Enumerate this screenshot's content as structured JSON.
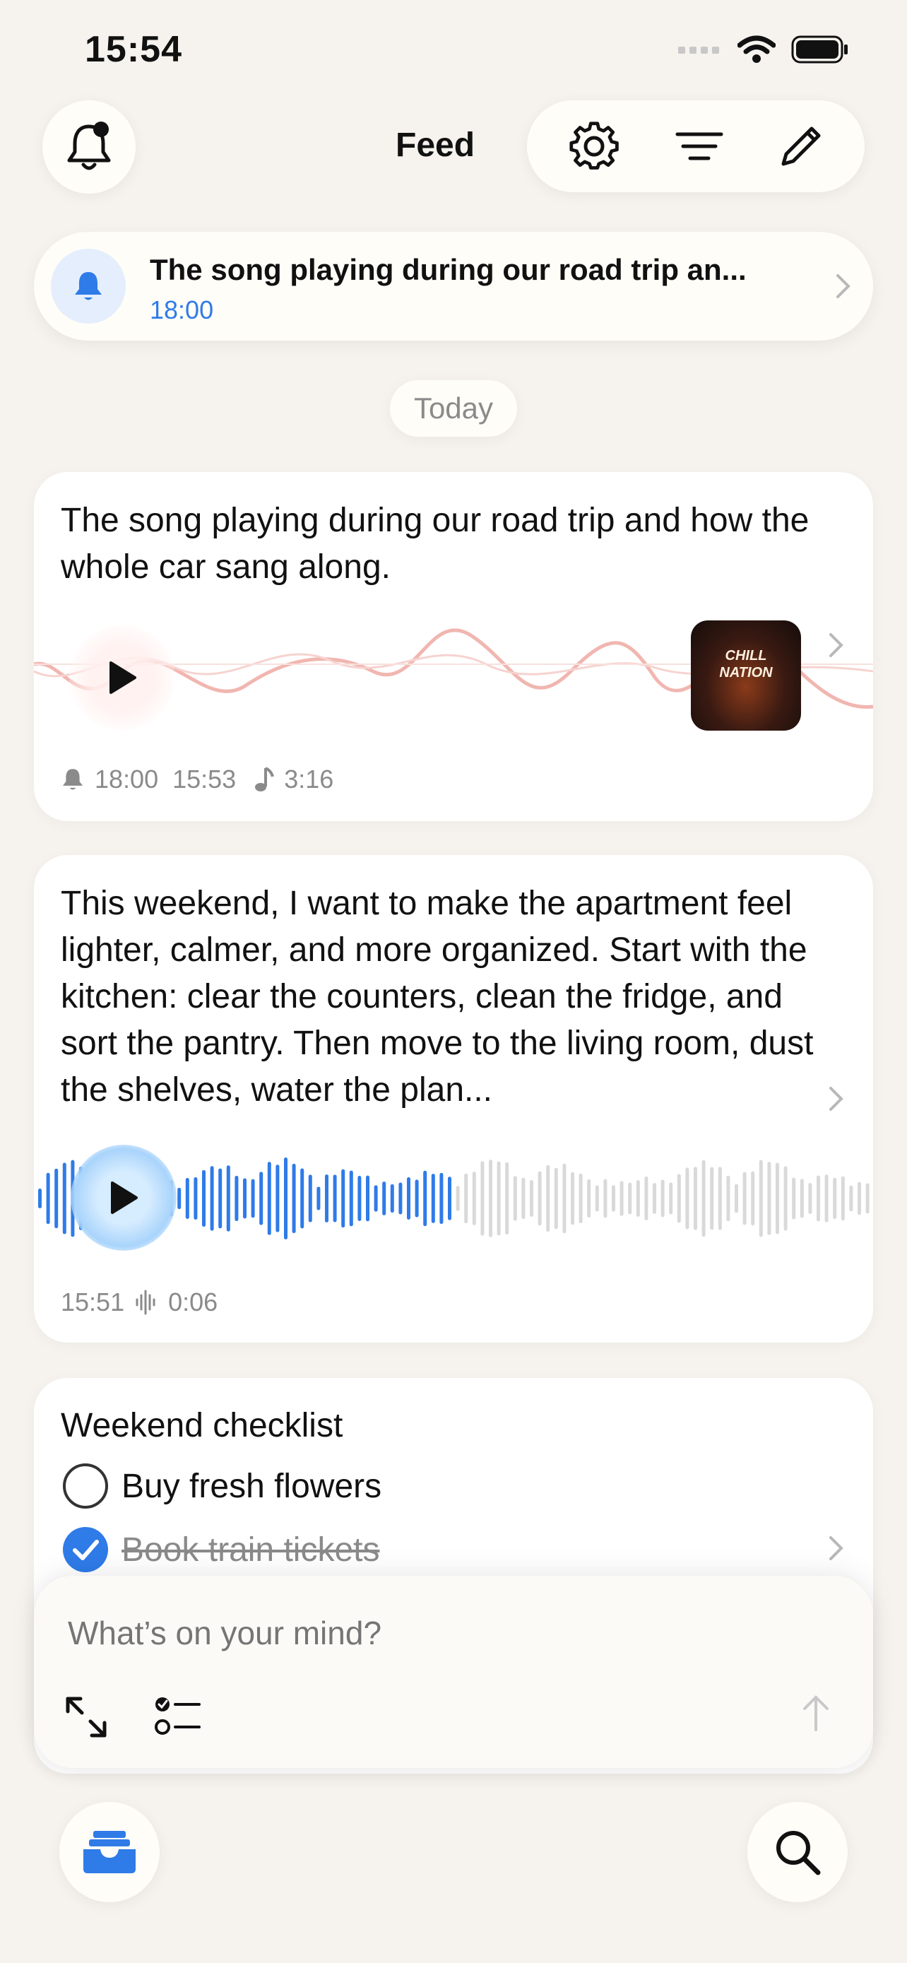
{
  "status": {
    "time": "15:54"
  },
  "header": {
    "title": "Feed",
    "icons": [
      "bell-icon",
      "gear-icon",
      "filter-icon",
      "pencil-icon"
    ]
  },
  "banner": {
    "title": "The song playing during our road trip an...",
    "time": "18:00"
  },
  "section_label": "Today",
  "notes": [
    {
      "text": "The song playing during our road trip and how the whole car sang along.",
      "album_art_text": "CHILL NATION",
      "meta": {
        "reminder": "18:00",
        "created": "15:53",
        "duration": "3:16"
      }
    },
    {
      "text": "This weekend, I want to make the apartment feel lighter, calmer, and more organized. Start with the kitchen: clear the counters, clean the fridge, and sort the pantry. Then move to the living room, dust the shelves, water the plan...",
      "meta": {
        "created": "15:51",
        "duration": "0:06"
      },
      "progress": 0.5
    }
  ],
  "checklist": {
    "title": "Weekend checklist",
    "items": [
      {
        "label": "Buy fresh flowers",
        "checked": false
      },
      {
        "label": "Book train tickets",
        "checked": true
      }
    ]
  },
  "composer": {
    "placeholder": "What’s on your mind?"
  },
  "colors": {
    "accent": "#2f7be8",
    "background": "#f6f3ee"
  }
}
